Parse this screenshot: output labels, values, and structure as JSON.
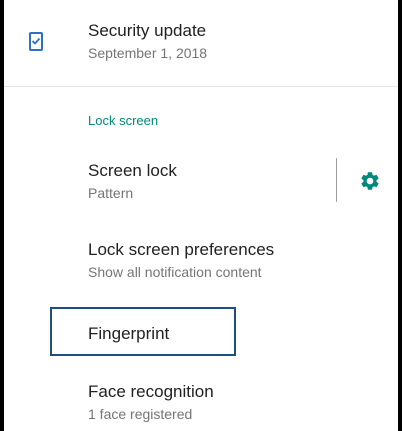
{
  "security_update": {
    "title": "Security update",
    "subtitle": "September 1, 2018",
    "icon": "phone-check-icon"
  },
  "lock_screen_section": {
    "header": "Lock screen"
  },
  "items": [
    {
      "title": "Screen lock",
      "subtitle": "Pattern",
      "action_icon": "gear-icon"
    },
    {
      "title": "Lock screen preferences",
      "subtitle": "Show all notification content"
    },
    {
      "title": "Fingerprint",
      "subtitle": ""
    },
    {
      "title": "Face recognition",
      "subtitle": "1 face registered"
    }
  ],
  "colors": {
    "accent": "#00897b",
    "icon": "#2f6fbf",
    "highlight": "#1f4f82"
  }
}
